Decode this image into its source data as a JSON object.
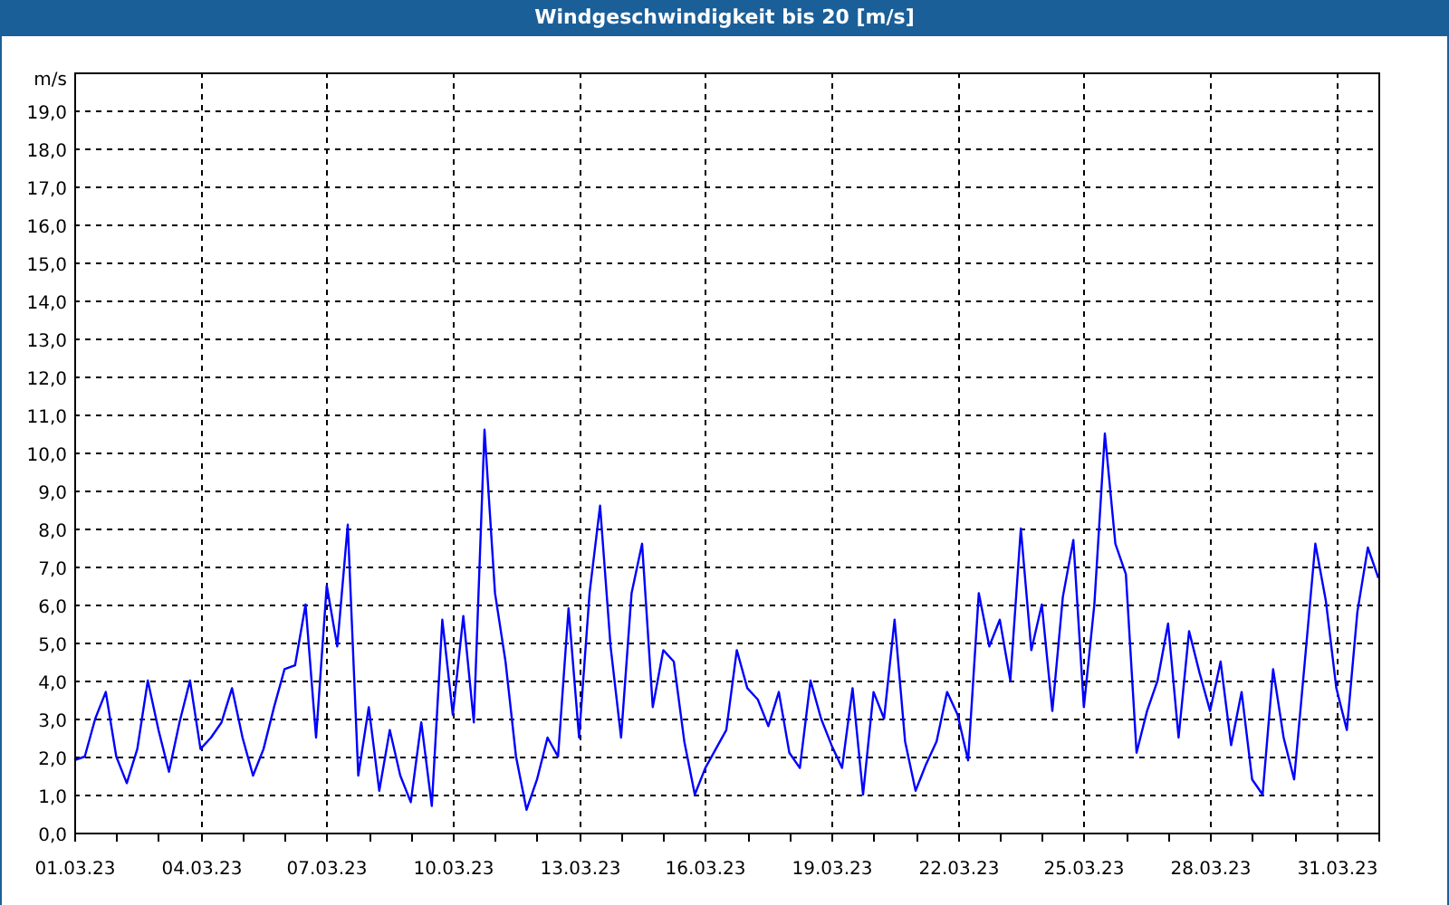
{
  "window": {
    "title": "Windgeschwindigkeit bis 20 [m/s]"
  },
  "chart": {
    "chart_data": {
      "type": "line",
      "ylabel": "m/s",
      "categories": [
        "01.03.23",
        null,
        null,
        null,
        null,
        null,
        null,
        null,
        null,
        null,
        null,
        null,
        "04.03.23",
        null,
        null,
        null,
        null,
        null,
        null,
        null,
        null,
        null,
        null,
        null,
        "07.03.23",
        null,
        null,
        null,
        null,
        null,
        null,
        null,
        null,
        null,
        null,
        null,
        "10.03.23",
        null,
        null,
        null,
        null,
        null,
        null,
        null,
        null,
        null,
        null,
        null,
        "13.03.23",
        null,
        null,
        null,
        null,
        null,
        null,
        null,
        null,
        null,
        null,
        null,
        "16.03.23",
        null,
        null,
        null,
        null,
        null,
        null,
        null,
        null,
        null,
        null,
        null,
        "19.03.23",
        null,
        null,
        null,
        null,
        null,
        null,
        null,
        null,
        null,
        null,
        null,
        "22.03.23",
        null,
        null,
        null,
        null,
        null,
        null,
        null,
        null,
        null,
        null,
        null,
        "25.03.23",
        null,
        null,
        null,
        null,
        null,
        null,
        null,
        null,
        null,
        null,
        null,
        "28.03.23",
        null,
        null,
        null,
        null,
        null,
        null,
        null,
        null,
        null,
        null,
        null,
        "31.03.23",
        null,
        null,
        null,
        null
      ],
      "series": [
        {
          "color": "#0000ff",
          "values": [
            1.9,
            2.0,
            3.0,
            3.7,
            2.0,
            1.3,
            2.2,
            4.0,
            2.7,
            1.6,
            2.9,
            4.0,
            2.2,
            2.5,
            2.9,
            3.8,
            2.5,
            1.5,
            2.2,
            3.3,
            4.3,
            4.4,
            6.0,
            2.5,
            6.5,
            4.9,
            8.1,
            1.5,
            3.3,
            1.1,
            2.7,
            1.5,
            0.8,
            2.9,
            0.7,
            5.6,
            3.1,
            5.7,
            2.9,
            10.6,
            6.3,
            4.5,
            2.0,
            0.6,
            1.4,
            2.5,
            2.0,
            5.9,
            2.5,
            6.3,
            8.6,
            4.9,
            2.5,
            6.3,
            7.6,
            3.3,
            4.8,
            4.5,
            2.4,
            1.0,
            1.7,
            2.2,
            2.7,
            4.8,
            3.8,
            3.5,
            2.8,
            3.7,
            2.1,
            1.7,
            4.0,
            3.0,
            2.3,
            1.7,
            3.8,
            1.0,
            3.7,
            3.0,
            5.6,
            2.4,
            1.1,
            1.8,
            2.4,
            3.7,
            3.1,
            1.9,
            6.3,
            4.9,
            5.6,
            4.0,
            8.0,
            4.8,
            6.0,
            3.2,
            6.2,
            7.7,
            3.3,
            6.0,
            10.5,
            7.6,
            6.8,
            2.1,
            3.2,
            4.0,
            5.5,
            2.5,
            5.3,
            4.2,
            3.2,
            4.5,
            2.3,
            3.7,
            1.4,
            1.0,
            4.3,
            2.5,
            1.4,
            4.5,
            7.6,
            6.1,
            3.8,
            2.7,
            5.8,
            7.5,
            6.7
          ]
        }
      ],
      "grid": true,
      "ylim": [
        0,
        20
      ],
      "yticks": [
        {
          "value": 0,
          "label": "0,0"
        },
        {
          "value": 1,
          "label": "1,0"
        },
        {
          "value": 2,
          "label": "2,0"
        },
        {
          "value": 3,
          "label": "3,0"
        },
        {
          "value": 4,
          "label": "4,0"
        },
        {
          "value": 5,
          "label": "5,0"
        },
        {
          "value": 6,
          "label": "6,0"
        },
        {
          "value": 7,
          "label": "7,0"
        },
        {
          "value": 8,
          "label": "8,0"
        },
        {
          "value": 9,
          "label": "9,0"
        },
        {
          "value": 10,
          "label": "10,0"
        },
        {
          "value": 11,
          "label": "11,0"
        },
        {
          "value": 12,
          "label": "12,0"
        },
        {
          "value": 13,
          "label": "13,0"
        },
        {
          "value": 14,
          "label": "14,0"
        },
        {
          "value": 15,
          "label": "15,0"
        },
        {
          "value": 16,
          "label": "16,0"
        },
        {
          "value": 17,
          "label": "17,0"
        },
        {
          "value": 18,
          "label": "18,0"
        },
        {
          "value": 19,
          "label": "19,0"
        }
      ]
    }
  }
}
